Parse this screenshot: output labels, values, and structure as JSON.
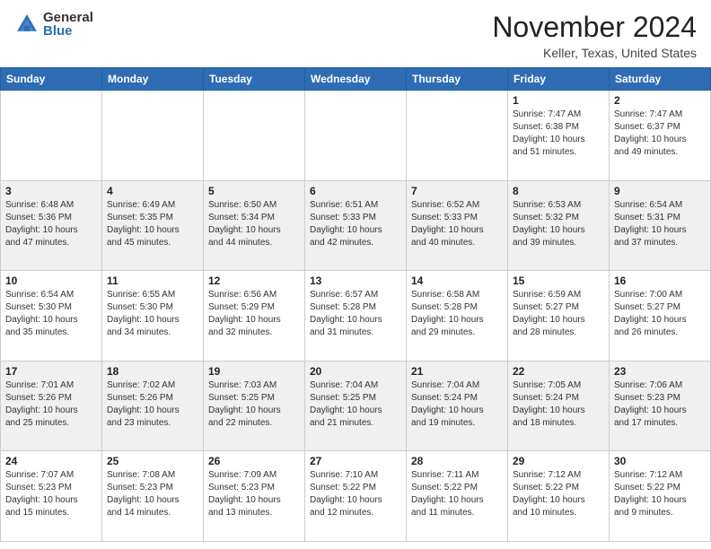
{
  "header": {
    "logo_general": "General",
    "logo_blue": "Blue",
    "month": "November 2024",
    "location": "Keller, Texas, United States"
  },
  "weekdays": [
    "Sunday",
    "Monday",
    "Tuesday",
    "Wednesday",
    "Thursday",
    "Friday",
    "Saturday"
  ],
  "weeks": [
    [
      {
        "day": "",
        "info": ""
      },
      {
        "day": "",
        "info": ""
      },
      {
        "day": "",
        "info": ""
      },
      {
        "day": "",
        "info": ""
      },
      {
        "day": "",
        "info": ""
      },
      {
        "day": "1",
        "info": "Sunrise: 7:47 AM\nSunset: 6:38 PM\nDaylight: 10 hours\nand 51 minutes."
      },
      {
        "day": "2",
        "info": "Sunrise: 7:47 AM\nSunset: 6:37 PM\nDaylight: 10 hours\nand 49 minutes."
      }
    ],
    [
      {
        "day": "3",
        "info": "Sunrise: 6:48 AM\nSunset: 5:36 PM\nDaylight: 10 hours\nand 47 minutes."
      },
      {
        "day": "4",
        "info": "Sunrise: 6:49 AM\nSunset: 5:35 PM\nDaylight: 10 hours\nand 45 minutes."
      },
      {
        "day": "5",
        "info": "Sunrise: 6:50 AM\nSunset: 5:34 PM\nDaylight: 10 hours\nand 44 minutes."
      },
      {
        "day": "6",
        "info": "Sunrise: 6:51 AM\nSunset: 5:33 PM\nDaylight: 10 hours\nand 42 minutes."
      },
      {
        "day": "7",
        "info": "Sunrise: 6:52 AM\nSunset: 5:33 PM\nDaylight: 10 hours\nand 40 minutes."
      },
      {
        "day": "8",
        "info": "Sunrise: 6:53 AM\nSunset: 5:32 PM\nDaylight: 10 hours\nand 39 minutes."
      },
      {
        "day": "9",
        "info": "Sunrise: 6:54 AM\nSunset: 5:31 PM\nDaylight: 10 hours\nand 37 minutes."
      }
    ],
    [
      {
        "day": "10",
        "info": "Sunrise: 6:54 AM\nSunset: 5:30 PM\nDaylight: 10 hours\nand 35 minutes."
      },
      {
        "day": "11",
        "info": "Sunrise: 6:55 AM\nSunset: 5:30 PM\nDaylight: 10 hours\nand 34 minutes."
      },
      {
        "day": "12",
        "info": "Sunrise: 6:56 AM\nSunset: 5:29 PM\nDaylight: 10 hours\nand 32 minutes."
      },
      {
        "day": "13",
        "info": "Sunrise: 6:57 AM\nSunset: 5:28 PM\nDaylight: 10 hours\nand 31 minutes."
      },
      {
        "day": "14",
        "info": "Sunrise: 6:58 AM\nSunset: 5:28 PM\nDaylight: 10 hours\nand 29 minutes."
      },
      {
        "day": "15",
        "info": "Sunrise: 6:59 AM\nSunset: 5:27 PM\nDaylight: 10 hours\nand 28 minutes."
      },
      {
        "day": "16",
        "info": "Sunrise: 7:00 AM\nSunset: 5:27 PM\nDaylight: 10 hours\nand 26 minutes."
      }
    ],
    [
      {
        "day": "17",
        "info": "Sunrise: 7:01 AM\nSunset: 5:26 PM\nDaylight: 10 hours\nand 25 minutes."
      },
      {
        "day": "18",
        "info": "Sunrise: 7:02 AM\nSunset: 5:26 PM\nDaylight: 10 hours\nand 23 minutes."
      },
      {
        "day": "19",
        "info": "Sunrise: 7:03 AM\nSunset: 5:25 PM\nDaylight: 10 hours\nand 22 minutes."
      },
      {
        "day": "20",
        "info": "Sunrise: 7:04 AM\nSunset: 5:25 PM\nDaylight: 10 hours\nand 21 minutes."
      },
      {
        "day": "21",
        "info": "Sunrise: 7:04 AM\nSunset: 5:24 PM\nDaylight: 10 hours\nand 19 minutes."
      },
      {
        "day": "22",
        "info": "Sunrise: 7:05 AM\nSunset: 5:24 PM\nDaylight: 10 hours\nand 18 minutes."
      },
      {
        "day": "23",
        "info": "Sunrise: 7:06 AM\nSunset: 5:23 PM\nDaylight: 10 hours\nand 17 minutes."
      }
    ],
    [
      {
        "day": "24",
        "info": "Sunrise: 7:07 AM\nSunset: 5:23 PM\nDaylight: 10 hours\nand 15 minutes."
      },
      {
        "day": "25",
        "info": "Sunrise: 7:08 AM\nSunset: 5:23 PM\nDaylight: 10 hours\nand 14 minutes."
      },
      {
        "day": "26",
        "info": "Sunrise: 7:09 AM\nSunset: 5:23 PM\nDaylight: 10 hours\nand 13 minutes."
      },
      {
        "day": "27",
        "info": "Sunrise: 7:10 AM\nSunset: 5:22 PM\nDaylight: 10 hours\nand 12 minutes."
      },
      {
        "day": "28",
        "info": "Sunrise: 7:11 AM\nSunset: 5:22 PM\nDaylight: 10 hours\nand 11 minutes."
      },
      {
        "day": "29",
        "info": "Sunrise: 7:12 AM\nSunset: 5:22 PM\nDaylight: 10 hours\nand 10 minutes."
      },
      {
        "day": "30",
        "info": "Sunrise: 7:12 AM\nSunset: 5:22 PM\nDaylight: 10 hours\nand 9 minutes."
      }
    ]
  ]
}
